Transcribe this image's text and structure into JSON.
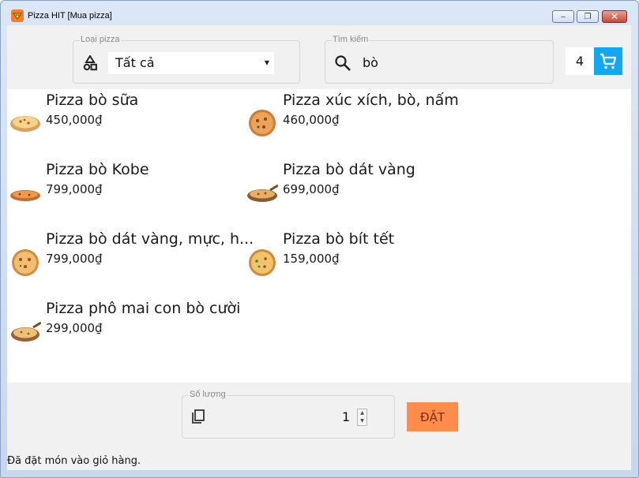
{
  "window": {
    "title": "Pizza HIT [Mua pizza]",
    "minimize_glyph": "‒",
    "maximize_glyph": "❐",
    "close_glyph": "✕"
  },
  "header": {
    "category": {
      "label": "Loại pizza",
      "value": "Tất cả",
      "icon": "shapes-icon"
    },
    "search": {
      "label": "Tìm kiếm",
      "value": "bò",
      "icon": "search-icon"
    },
    "cart": {
      "count": "4",
      "icon": "cart-icon",
      "color": "#13a7f2"
    }
  },
  "products": [
    {
      "name": "Pizza bò sữa",
      "price": "450,000₫"
    },
    {
      "name": "Pizza xúc xích, bò, nấm",
      "price": "460,000₫"
    },
    {
      "name": "Pizza bò Kobe",
      "price": "799,000₫"
    },
    {
      "name": "Pizza bò dát vàng",
      "price": "699,000₫"
    },
    {
      "name": "Pizza bò dát vàng, mực, h...",
      "price": "799,000₫"
    },
    {
      "name": "Pizza bò bít tết",
      "price": "159,000₫"
    },
    {
      "name": "Pizza phô mai con bò cười",
      "price": "299,000₫"
    }
  ],
  "order": {
    "quantity_label": "Số lượng",
    "quantity": "1",
    "button": "ĐẶT",
    "button_color": "#ff8c4a",
    "spin_up": "▲",
    "spin_down": "▼"
  },
  "status": {
    "text": "Đã đặt món vào giỏ hàng."
  }
}
